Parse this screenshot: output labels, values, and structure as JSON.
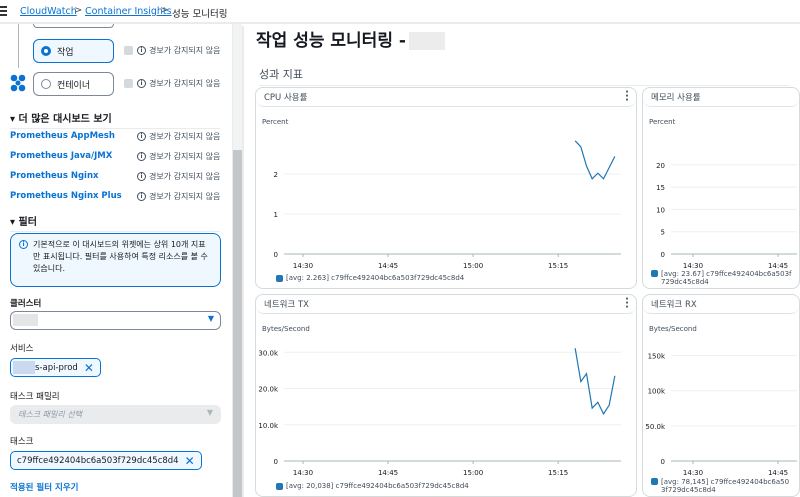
{
  "breadcrumb": {
    "items": [
      "CloudWatch",
      "Container Insights"
    ],
    "current": "성능 모니터링"
  },
  "left": {
    "task_radio": "작업",
    "container_radio": "컨테이너",
    "no_alarm": "경보가 감지되지 않음",
    "more_dashboards": "더 많은 대시보드 보기",
    "links": [
      "Prometheus AppMesh",
      "Prometheus Java/JMX",
      "Prometheus Nginx",
      "Prometheus Nginx Plus"
    ],
    "filter_title": "필터",
    "info": "기본적으로 이 대시보드의 위젯에는 상위 10개 지표만 표시됩니다. 필터를 사용하여 특정 리소스를 볼 수 있습니다.",
    "cluster_label": "클러스터",
    "service_label": "서비스",
    "service_token": "s-api-prod",
    "task_family_label": "태스크 패밀리",
    "task_family_placeholder": "태스크 패밀리 선택",
    "task_label": "태스크",
    "task_token": "c79ffce492404bc6a503f729dc45c8d4",
    "clear_filters": "적용된 필터 지우기"
  },
  "main": {
    "title": "작업 성능 모니터링 -",
    "section": "성과 지표"
  },
  "chart_data": [
    {
      "type": "line",
      "title": "CPU 사용률",
      "ylabel": "Percent",
      "yticks": [
        "0",
        "1",
        "2"
      ],
      "ylim": [
        0,
        2.9
      ],
      "xticks": [
        "14:30",
        "14:45",
        "15:00",
        "15:15"
      ],
      "legend": "[avg: 2.263] c79ffce492404bc6a503f729dc45c8d4",
      "x": [
        "15:18",
        "15:19",
        "15:20",
        "15:21",
        "15:22",
        "15:23",
        "15:25"
      ],
      "y": [
        2.83,
        2.68,
        2.2,
        1.88,
        2.02,
        1.88,
        2.44
      ]
    },
    {
      "type": "line",
      "title": "메모리 사용률",
      "ylabel": "Percent",
      "yticks": [
        "0",
        "5",
        "10",
        "15",
        "20"
      ],
      "ylim": [
        0,
        26
      ],
      "xticks": [
        "14:30",
        "14:45"
      ],
      "legend": "[avg: 23.67] c79ffce492404bc6a503f729dc45c8d4",
      "x": [],
      "y": []
    },
    {
      "type": "line",
      "title": "네트워크 TX",
      "ylabel": "Bytes/Second",
      "yticks": [
        "0",
        "10.0k",
        "20.0k",
        "30.0k"
      ],
      "ylim": [
        0,
        32000
      ],
      "xticks": [
        "14:30",
        "14:45",
        "15:00",
        "15:15"
      ],
      "legend": "[avg: 20,038] c79ffce492404bc6a503f729dc45c8d4",
      "x": [
        "15:18",
        "15:19",
        "15:20",
        "15:21",
        "15:22",
        "15:23",
        "15:24",
        "15:25"
      ],
      "y": [
        31100,
        21900,
        24100,
        14600,
        16200,
        13000,
        15400,
        23500
      ]
    },
    {
      "type": "line",
      "title": "네트워크 RX",
      "ylabel": "Bytes/Second",
      "yticks": [
        "0",
        "50.0k",
        "100k",
        "150k"
      ],
      "ylim": [
        0,
        165000
      ],
      "xticks": [
        "14:30",
        "14:45"
      ],
      "legend": "[avg: 78,145] c79ffce492404bc6a503f729dc45c8d4",
      "x": [],
      "y": []
    }
  ]
}
